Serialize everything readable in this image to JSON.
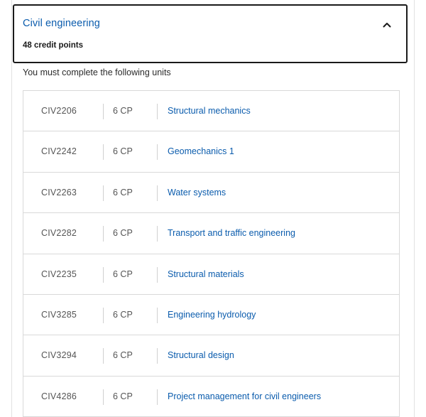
{
  "section": {
    "title": "Civil engineering",
    "credit_points": "48 credit points",
    "expanded": true,
    "toggle_icon": "chevron-up-icon"
  },
  "instructions": "You must complete the following units",
  "units": [
    {
      "code": "CIV2206",
      "cp": "6 CP",
      "name": "Structural mechanics"
    },
    {
      "code": "CIV2242",
      "cp": "6 CP",
      "name": "Geomechanics 1"
    },
    {
      "code": "CIV2263",
      "cp": "6 CP",
      "name": "Water systems"
    },
    {
      "code": "CIV2282",
      "cp": "6 CP",
      "name": "Transport and traffic engineering"
    },
    {
      "code": "CIV2235",
      "cp": "6 CP",
      "name": "Structural materials"
    },
    {
      "code": "CIV3285",
      "cp": "6 CP",
      "name": "Engineering hydrology"
    },
    {
      "code": "CIV3294",
      "cp": "6 CP",
      "name": "Structural design"
    },
    {
      "code": "CIV4286",
      "cp": "6 CP",
      "name": "Project management for civil engineers"
    }
  ],
  "colors": {
    "link": "#0b5cad",
    "text": "#1a1a1a",
    "muted": "#555555",
    "border": "#d9d9d9"
  }
}
